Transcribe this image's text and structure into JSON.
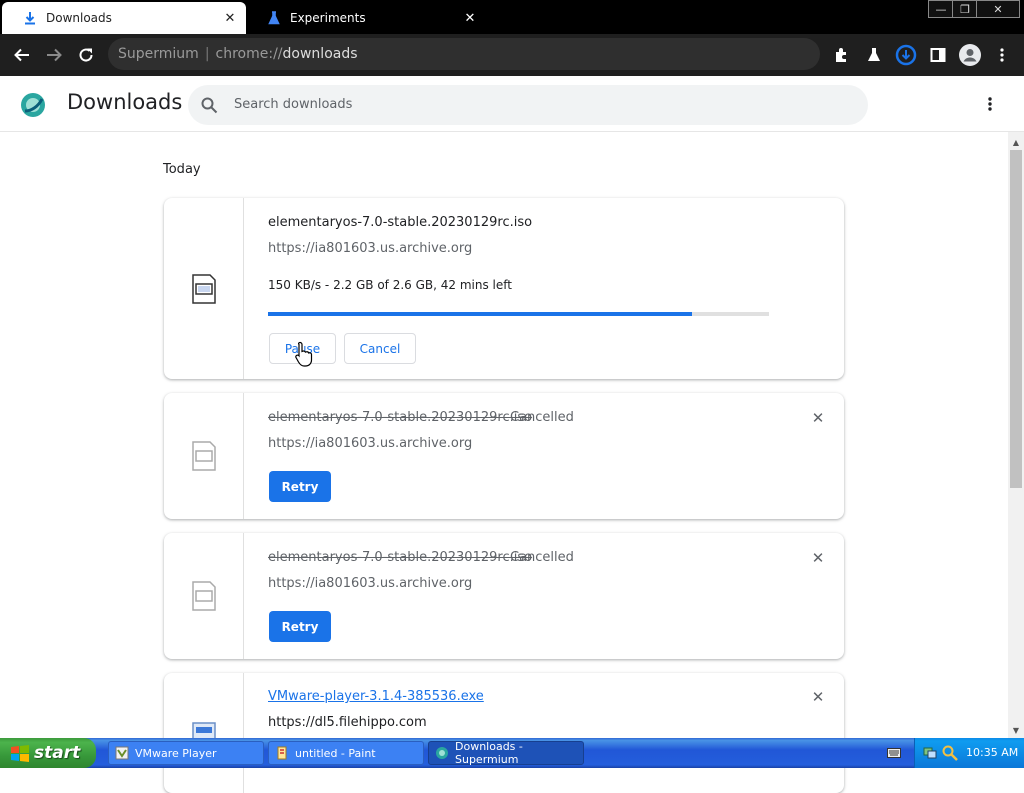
{
  "tabs": [
    {
      "title": "Downloads",
      "icon": "download-icon",
      "active": true
    },
    {
      "title": "Experiments",
      "icon": "flask-icon",
      "active": false
    }
  ],
  "window_controls": {
    "minimize": "—",
    "restore": "❐",
    "close": "✕"
  },
  "omnibox": {
    "site": "Supermium",
    "separator": "|",
    "url_prefix": "chrome://",
    "url_page": "downloads"
  },
  "page": {
    "title": "Downloads",
    "search_placeholder": "Search downloads",
    "section": "Today"
  },
  "downloads": [
    {
      "file_name": "elementaryos-7.0-stable.20230129rc.iso",
      "url": "https://ia801603.us.archive.org",
      "progress_text": "150 KB/s - 2.2 GB of 2.6 GB, 42 mins left",
      "progress_fraction": 0.846,
      "pause_label": "Pause",
      "cancel_label": "Cancel"
    },
    {
      "file_name": "elementaryos-7.0-stable.20230129rc.iso",
      "status": "Cancelled",
      "url": "https://ia801603.us.archive.org",
      "retry_label": "Retry"
    },
    {
      "file_name": "elementaryos-7.0-stable.20230129rc.iso",
      "status": "Cancelled",
      "url": "https://ia801603.us.archive.org",
      "retry_label": "Retry"
    },
    {
      "file_name": "VMware-player-3.1.4-385536.exe",
      "url": "https://dl5.filehippo.com"
    }
  ],
  "taskbar": {
    "start_label": "start",
    "tasks": [
      {
        "label": "VMware Player",
        "icon": "vmware-icon",
        "active": false
      },
      {
        "label": "untitled - Paint",
        "icon": "paint-icon",
        "active": false
      },
      {
        "label": "Downloads - Supermium",
        "icon": "supermium-icon",
        "active": true
      }
    ],
    "clock": "10:35 AM"
  },
  "colors": {
    "accent": "#1a73e8",
    "tab_strip": "#000000",
    "toolbar": "#1f1f1f"
  }
}
